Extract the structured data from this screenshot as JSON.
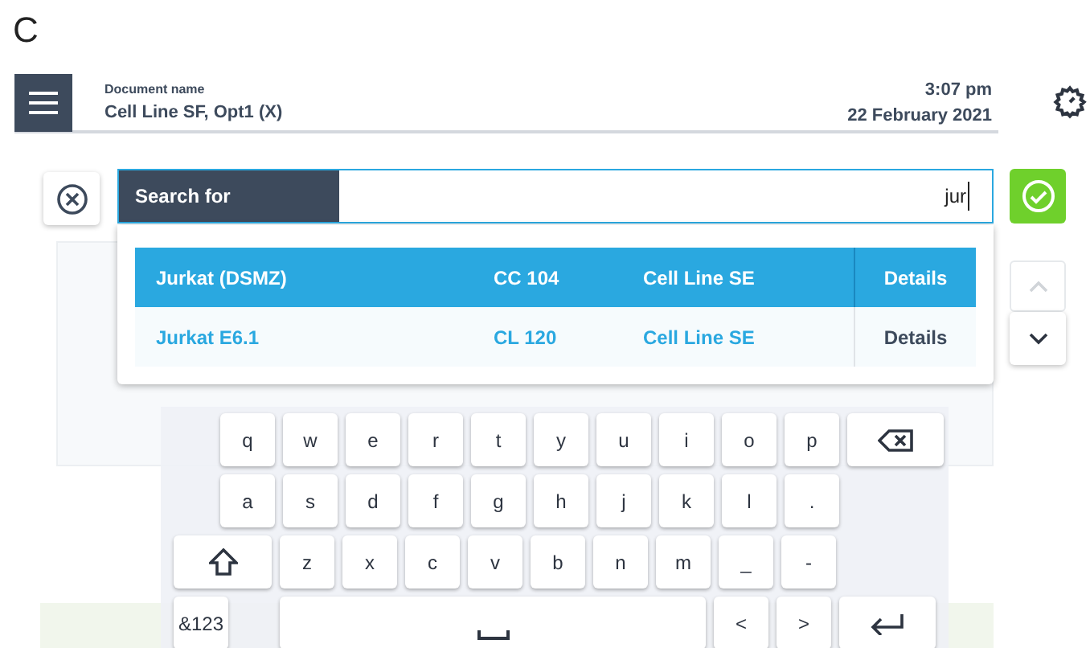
{
  "panel_label": "C",
  "header": {
    "doc_label": "Document name",
    "doc_name": "Cell Line SF, Opt1 (X)",
    "time": "3:07 pm",
    "date": "22 February 2021"
  },
  "search": {
    "label": "Search for",
    "value": "jur"
  },
  "results": [
    {
      "name": "Jurkat (DSMZ)",
      "code": "CC 104",
      "type": "Cell Line SE",
      "details": "Details",
      "selected": true
    },
    {
      "name": "Jurkat E6.1",
      "code": "CL 120",
      "type": "Cell Line SE",
      "details": "Details",
      "selected": false
    }
  ],
  "keyboard": [
    [
      {
        "kind": "char",
        "label": "q"
      },
      {
        "kind": "char",
        "label": "w"
      },
      {
        "kind": "char",
        "label": "e"
      },
      {
        "kind": "char",
        "label": "r"
      },
      {
        "kind": "char",
        "label": "t"
      },
      {
        "kind": "char",
        "label": "y"
      },
      {
        "kind": "char",
        "label": "u"
      },
      {
        "kind": "char",
        "label": "i"
      },
      {
        "kind": "char",
        "label": "o"
      },
      {
        "kind": "char",
        "label": "p"
      },
      {
        "kind": "backspace"
      }
    ],
    [
      {
        "kind": "char",
        "label": "a"
      },
      {
        "kind": "char",
        "label": "s"
      },
      {
        "kind": "char",
        "label": "d"
      },
      {
        "kind": "char",
        "label": "f"
      },
      {
        "kind": "char",
        "label": "g"
      },
      {
        "kind": "char",
        "label": "h"
      },
      {
        "kind": "char",
        "label": "j"
      },
      {
        "kind": "char",
        "label": "k"
      },
      {
        "kind": "char",
        "label": "l"
      },
      {
        "kind": "char",
        "label": "."
      }
    ],
    [
      {
        "kind": "shift"
      },
      {
        "kind": "char",
        "label": "z"
      },
      {
        "kind": "char",
        "label": "x"
      },
      {
        "kind": "char",
        "label": "c"
      },
      {
        "kind": "char",
        "label": "v"
      },
      {
        "kind": "char",
        "label": "b"
      },
      {
        "kind": "char",
        "label": "n"
      },
      {
        "kind": "char",
        "label": "m"
      },
      {
        "kind": "char",
        "label": "_"
      },
      {
        "kind": "char",
        "label": "-"
      }
    ],
    [
      {
        "kind": "mode",
        "label": "&123"
      },
      {
        "kind": "space"
      },
      {
        "kind": "char",
        "label": "<"
      },
      {
        "kind": "char",
        "label": ">"
      },
      {
        "kind": "enter"
      }
    ]
  ]
}
